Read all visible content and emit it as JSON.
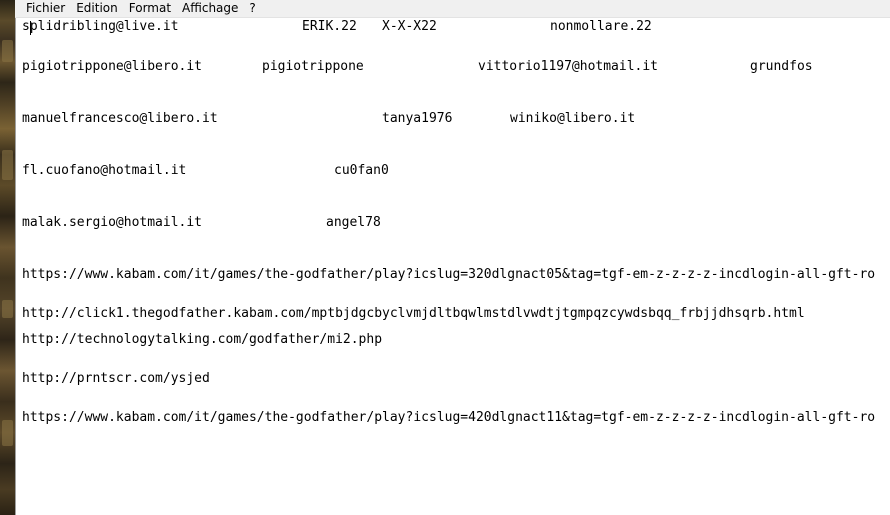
{
  "menu": {
    "items": [
      "Fichier",
      "Edition",
      "Format",
      "Affichage",
      "?"
    ]
  },
  "document": {
    "line1": {
      "c1": "splidribling@live.it",
      "c2": "ERIK.22",
      "c3": "X-X-X22",
      "c4": "nonmollare.22"
    },
    "line2": {
      "c1": "pigiotrippone@libero.it",
      "c2": "pigiotrippone",
      "c3": "vittorio1197@hotmail.it",
      "c4": "grundfos"
    },
    "line3": {
      "c1": "manuelfrancesco@libero.it",
      "c2": "tanya1976",
      "c3": "winiko@libero.it"
    },
    "line4": {
      "c1": "fl.cuofano@hotmail.it",
      "c2": "cu0fan0"
    },
    "line5": {
      "c1": "malak.sergio@hotmail.it",
      "c2": "angel78"
    },
    "url1": "https://www.kabam.com/it/games/the-godfather/play?icslug=320dlgnact05&tag=tgf-em-z-z-z-z-incdlogin-all-gft-ro",
    "url2": "http://click1.thegodfather.kabam.com/mptbjdgcbyclvmjdltbqwlmstdlvwdtjtgmpqzcywdsbqq_frbjjdhsqrb.html",
    "url3": "http://technologytalking.com/godfather/mi2.php",
    "url4": "http://prntscr.com/ysjed",
    "url5": "https://www.kabam.com/it/games/the-godfather/play?icslug=420dlgnact11&tag=tgf-em-z-z-z-z-incdlogin-all-gft-ro"
  }
}
